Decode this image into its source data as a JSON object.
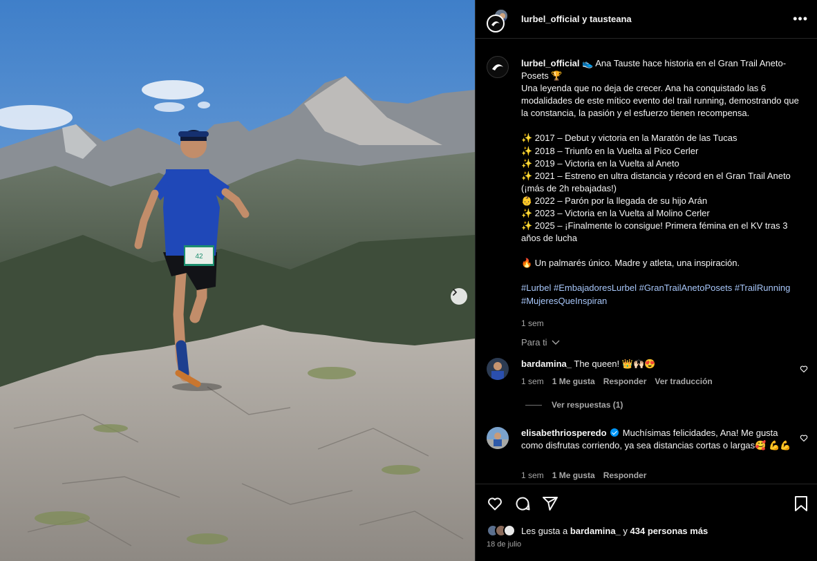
{
  "header": {
    "title": "lurbel_official y tausteana",
    "more_label": "•••"
  },
  "caption": {
    "username": "lurbel_official",
    "intro": "👟 Ana Tauste hace historia en el Gran Trail Aneto-Posets 🏆",
    "para1": "Una leyenda que no deja de crecer. Ana ha conquistado las 6 modalidades de este mítico evento del trail running, demostrando que la constancia, la pasión y el esfuerzo tienen recompensa.",
    "timeline": [
      "✨ 2017 – Debut y victoria en la Maratón de las Tucas",
      "✨ 2018 – Triunfo en la Vuelta al Pico Cerler",
      "✨ 2019 – Victoria en la Vuelta al Aneto",
      "✨ 2021 – Estreno en ultra distancia y récord en el Gran Trail Aneto (¡más de 2h rebajadas!)",
      "👶 2022 – Parón por la llegada de su hijo Arán",
      "✨ 2023 – Victoria en la Vuelta al Molino Cerler",
      "✨ 2025 – ¡Finalmente lo consigue! Primera fémina en el KV tras 3 años de lucha"
    ],
    "closing": "🔥 Un palmarés único. Madre y atleta, una inspiración.",
    "hashtags": [
      "#Lurbel",
      "#EmbajadoresLurbel",
      "#GranTrailAnetoPosets",
      "#TrailRunning",
      "#MujeresQueInspiran"
    ],
    "time": "1 sem"
  },
  "para_ti": "Para ti",
  "comments": [
    {
      "username": "bardamina_",
      "text": "The queen! 👑🙌🏻😍",
      "time": "1 sem",
      "likes": "1 Me gusta",
      "reply": "Responder",
      "translate": "Ver traducción"
    },
    {
      "username": "elisabethriosperedo",
      "text": "Muchísimas felicidades, Ana! Me gusta como disfrutas corriendo, ya sea distancias cortas o largas🥰 💪💪",
      "time": "1 sem",
      "likes": "1 Me gusta",
      "reply": "Responder"
    }
  ],
  "view_replies": "Ver respuestas (1)",
  "likes": {
    "prefix": "Les gusta a ",
    "user": "bardamina_",
    "middle": " y ",
    "others": "434 personas más"
  },
  "date": "18 de julio",
  "colors": {
    "background": "#000000",
    "hashtag": "#a8c7fa",
    "muted": "#a8a8a8",
    "verified": "#0095f6"
  }
}
